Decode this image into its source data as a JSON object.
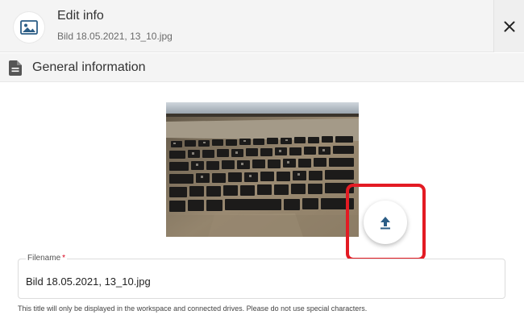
{
  "dialog": {
    "title": "Edit info",
    "subtitle": "Bild 18.05.2021, 13_10.jpg",
    "icon": "image-icon",
    "close_icon": "close-icon"
  },
  "section": {
    "icon": "document-icon",
    "label": "General information"
  },
  "preview": {
    "description_icon": "photo-preview",
    "upload_icon": "upload-icon",
    "highlight_color": "#e31b23"
  },
  "filename": {
    "label": "Filename",
    "required_mark": "*",
    "value": "Bild 18.05.2021, 13_10.jpg",
    "hint": "This title will only be displayed in the workspace and connected drives. Please do not use special characters."
  },
  "colors": {
    "accent": "#2b5d86",
    "header_bg": "#f4f4f4",
    "required": "#d9001b"
  }
}
